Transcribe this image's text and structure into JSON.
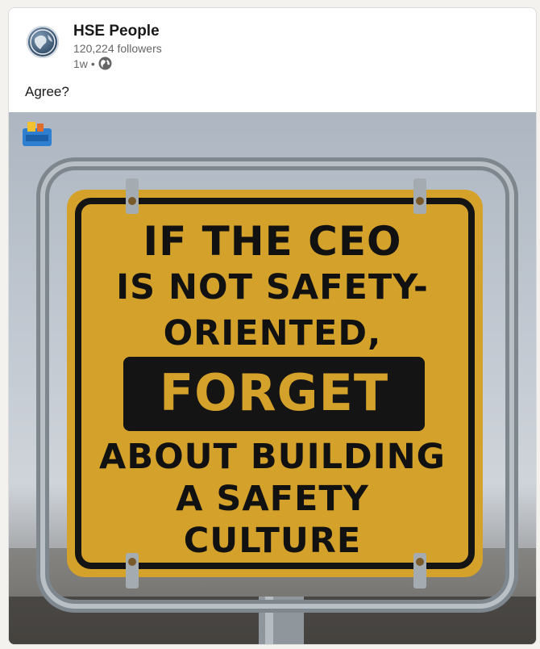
{
  "post": {
    "author": "HSE People",
    "followers": "120,224 followers",
    "time": "1w",
    "separator": "•",
    "visibility_icon": "globe-icon",
    "text": "Agree?"
  },
  "sign": {
    "line1": "IF THE CEO",
    "line2": "IS NOT SAFETY-",
    "line3": "ORIENTED,",
    "emphasis": "FORGET",
    "line5": "ABOUT BUILDING",
    "line6": "A SAFETY",
    "line7": "CULTURE"
  },
  "colors": {
    "sign_yellow": "#d4a12b",
    "sign_black": "#141414",
    "frame_metal": "#9aa3ab"
  }
}
